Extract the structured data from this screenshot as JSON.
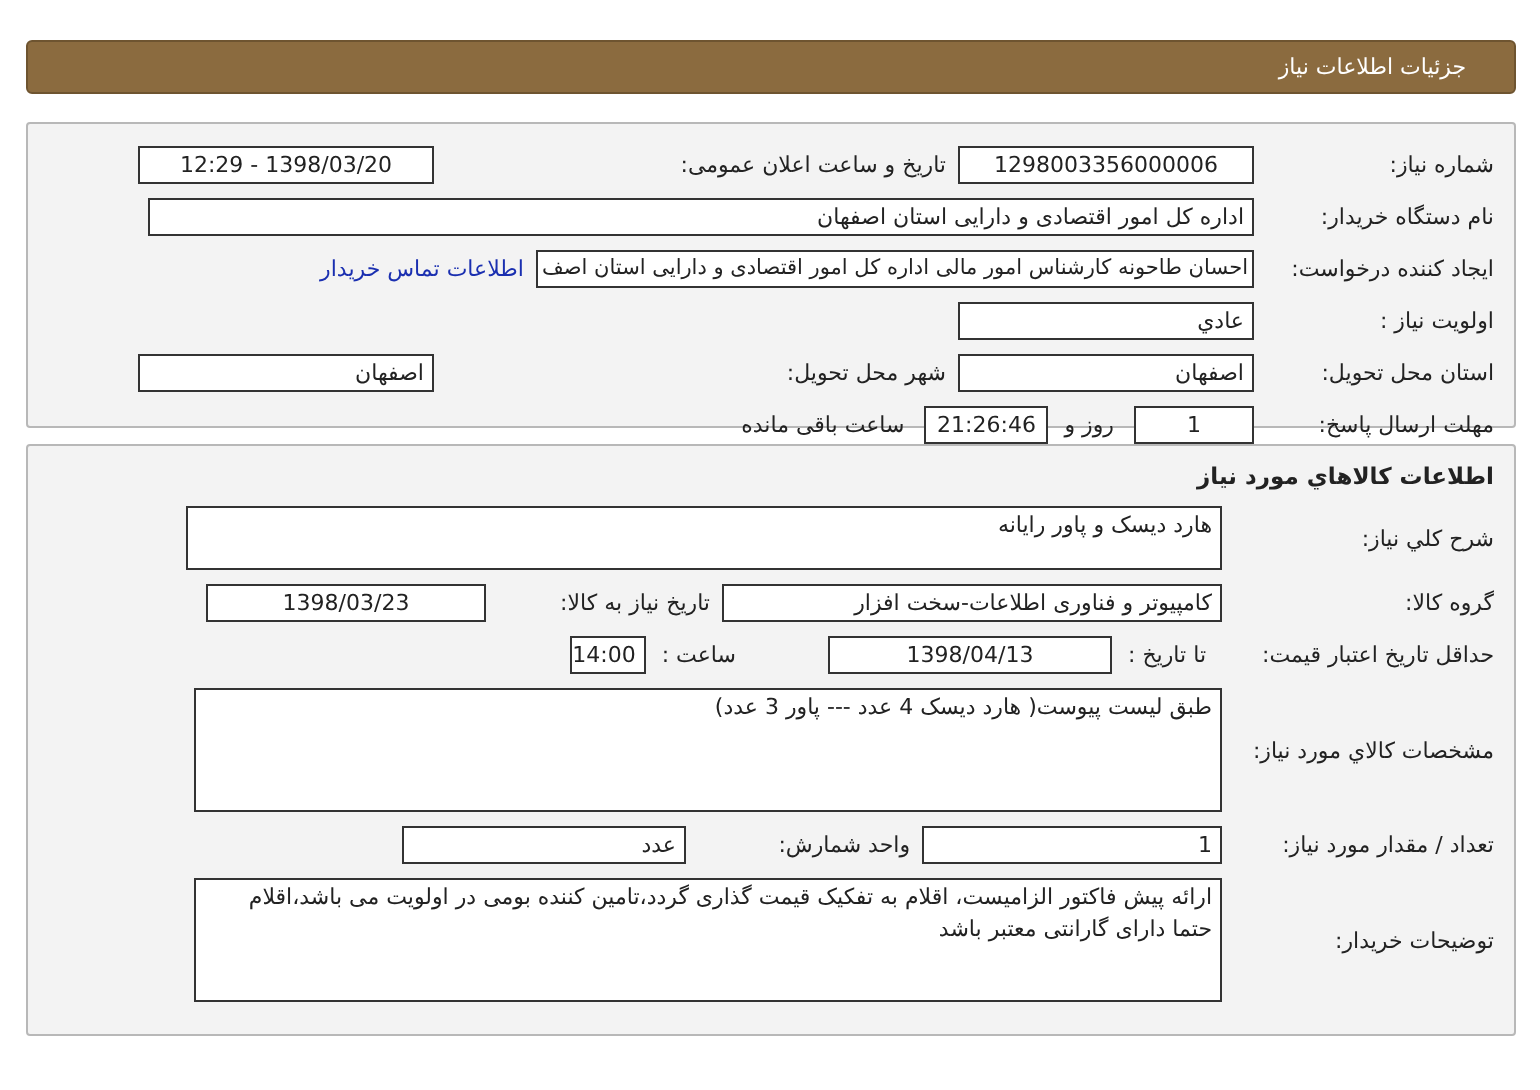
{
  "header": {
    "title": "جزئیات اطلاعات نیاز"
  },
  "need": {
    "need_number": {
      "label": "شماره نیاز:",
      "value": "1298003356000006"
    },
    "announce_datetime": {
      "label": "تاریخ و ساعت اعلان عمومی:",
      "value": "1398/03/20 - 12:29"
    },
    "buyer": {
      "label": "نام دستگاه خریدار:",
      "value": "اداره کل امور اقتصادی و دارایی استان اصفهان"
    },
    "requester": {
      "label": "ایجاد کننده درخواست:",
      "value": "احسان طاحونه کارشناس امور مالی اداره کل امور اقتصادی و دارایی استان اصف",
      "link": "اطلاعات تماس خریدار"
    },
    "priority": {
      "label": "اولویت نیاز :",
      "value": "عادي"
    },
    "province": {
      "label": "استان محل تحویل:",
      "value": "اصفهان"
    },
    "city": {
      "label": "شهر محل تحویل:",
      "value": "اصفهان"
    },
    "deadline": {
      "label": "مهلت ارسال پاسخ:",
      "days": "1",
      "days_unit": "روز و",
      "time": "21:26:46",
      "remaining": "ساعت باقی مانده"
    }
  },
  "goods": {
    "title": "اطلاعات کالاهاي مورد نياز",
    "description": {
      "label": "شرح کلي نياز:",
      "value": "هارد دیسک و پاور رایانه"
    },
    "group": {
      "label": "گروه کالا:",
      "value": "کامپیوتر و فناوری اطلاعات-سخت افزار"
    },
    "need_date": {
      "label": "تاریخ نیاز به کالا:",
      "value": "1398/03/23"
    },
    "price_validity": {
      "label": "حداقل تاریخ اعتبار قیمت:",
      "date_label": "تا تاریخ :",
      "date": "1398/04/13",
      "time_label": "ساعت :",
      "time": "14:00"
    },
    "specs": {
      "label": "مشخصات کالاي مورد نياز:",
      "value": "طبق لیست پیوست( هارد دیسک 4 عدد --- پاور 3 عدد)"
    },
    "quantity": {
      "label": "تعداد / مقدار مورد نیاز:",
      "value": "1"
    },
    "unit": {
      "label": "واحد شمارش:",
      "value": "عدد"
    },
    "notes": {
      "label": "توضیحات خریدار:",
      "value": "ارائه پیش فاکتور الزامیست، اقلام به تفکیک قیمت گذاری گردد،تامین کننده بومی در اولویت می باشد،اقلام حتما دارای گارانتی معتبر باشد"
    }
  }
}
